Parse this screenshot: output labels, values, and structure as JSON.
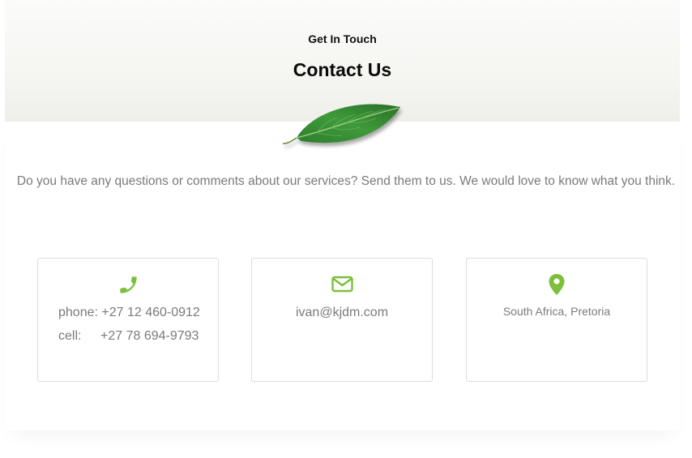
{
  "header": {
    "eyebrow": "Get In Touch",
    "title": "Contact Us"
  },
  "intro": "Do you have any questions or comments about our services? Send them to us. We would love to know what you think.",
  "contact": {
    "phone_line": "phone: +27 12 460-0912",
    "cell_label": "cell:",
    "cell_number": "+27 78 694-9793",
    "email": "ivan@kjdm.com",
    "address": "South Africa, Pretoria"
  },
  "icons": {
    "phone": "phone-icon",
    "email": "envelope-icon",
    "address": "map-pin-icon",
    "leaf": "leaf-image"
  },
  "colors": {
    "accent": "#7cbf3b",
    "text_muted": "#7a7a7a",
    "heading": "#0a0a0a",
    "card_border": "#dcdcdc"
  }
}
